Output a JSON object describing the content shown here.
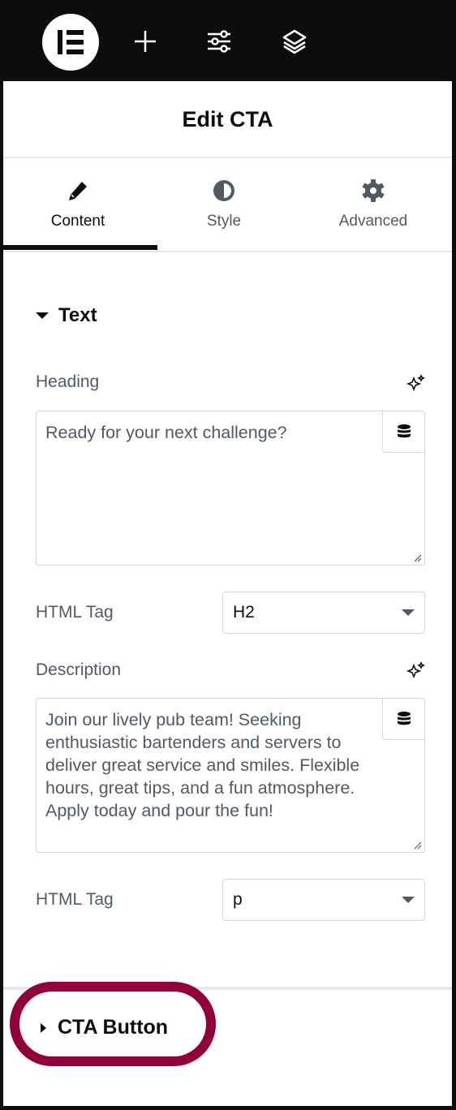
{
  "topbar": {
    "icons": [
      "elementor-logo-icon",
      "plus-icon",
      "sliders-icon",
      "layers-icon"
    ]
  },
  "panel": {
    "title": "Edit CTA"
  },
  "tabs": [
    {
      "label": "Content",
      "icon": "pencil-icon",
      "active": true
    },
    {
      "label": "Style",
      "icon": "half-circle-icon"
    },
    {
      "label": "Advanced",
      "icon": "gear-icon"
    }
  ],
  "section": {
    "title": "Text",
    "heading_label": "Heading",
    "heading_value": "Ready for your next challenge?",
    "html_tag_label": "HTML Tag",
    "heading_tag": "H2",
    "description_label": "Description",
    "description_value": "Join our lively pub team! Seeking enthusiastic bartenders and servers to deliver great service and smiles. Flexible hours, great tips, and a fun atmosphere. Apply today and pour the fun!",
    "description_tag": "p"
  },
  "cta_section": {
    "title": "CTA Button"
  },
  "colors": {
    "highlight": "#930039",
    "text": "#515962"
  }
}
